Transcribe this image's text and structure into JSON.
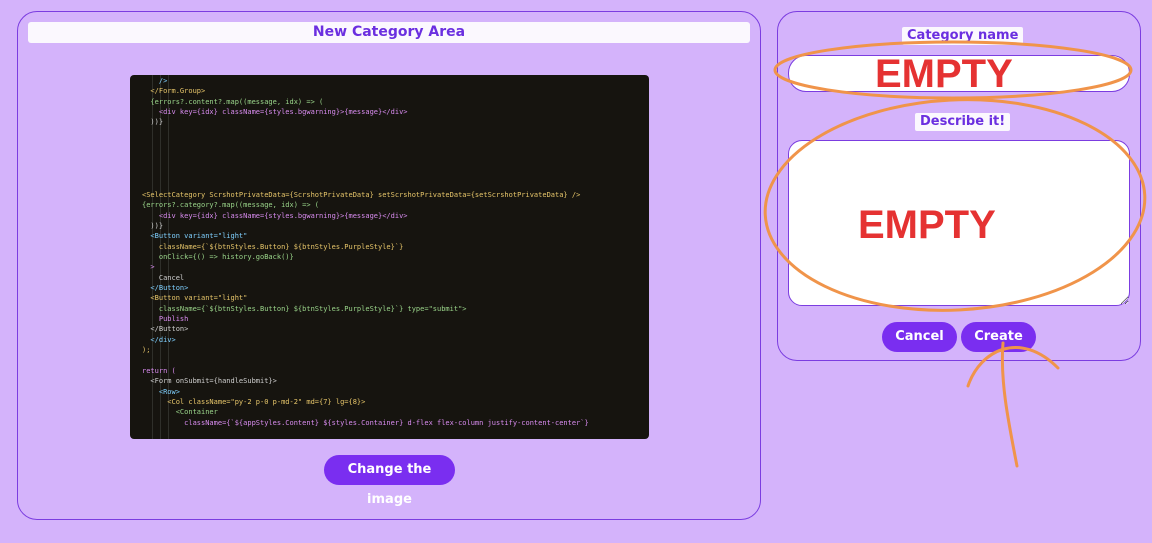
{
  "left": {
    "title": "New Category Area",
    "change_image_label": "Change the image",
    "code_lines": [
      "    />",
      "  </Form.Group>",
      "  {errors?.content?.map((message, idx) => (",
      "    <div key={idx} className={styles.bgwarning}>{message}</div>",
      "  ))}",
      "",
      "",
      "",
      "",
      "",
      "",
      "<SelectCategory ScrshotPrivateData={ScrshotPrivateData} setScrshotPrivateData={setScrshotPrivateData} />",
      "{errors?.category?.map((message, idx) => (",
      "    <div key={idx} className={styles.bgwarning}>{message}</div>",
      "  ))}",
      "  <Button variant=\"light\"",
      "    className={`${btnStyles.Button} ${btnStyles.PurpleStyle}`}",
      "    onClick={() => history.goBack()}",
      "  >",
      "    Cancel",
      "  </Button>",
      "  <Button variant=\"light\"",
      "    className={`${btnStyles.Button} ${btnStyles.PurpleStyle}`} type=\"submit\">",
      "    Publish",
      "  </Button>",
      "  </div>",
      ");",
      "",
      "return (",
      "  <Form onSubmit={handleSubmit}>",
      "    <Row>",
      "      <Col className=\"py-2 p-0 p-md-2\" md={7} lg={8}>",
      "        <Container",
      "          className={`${appStyles.Content} ${styles.Container} d-flex flex-column justify-content-center`}"
    ]
  },
  "right": {
    "name_label": "Category name",
    "describe_label": "Describe it!",
    "name_value": "",
    "describe_value": "",
    "cancel_label": "Cancel",
    "create_label": "Create"
  },
  "annotations": {
    "empty_name": "EMPTY",
    "empty_desc": "EMPTY"
  },
  "colors": {
    "background": "#d4b3fb",
    "accent": "#7a2ef0",
    "annotation_orange": "#f0944a",
    "annotation_red": "#e53232"
  }
}
